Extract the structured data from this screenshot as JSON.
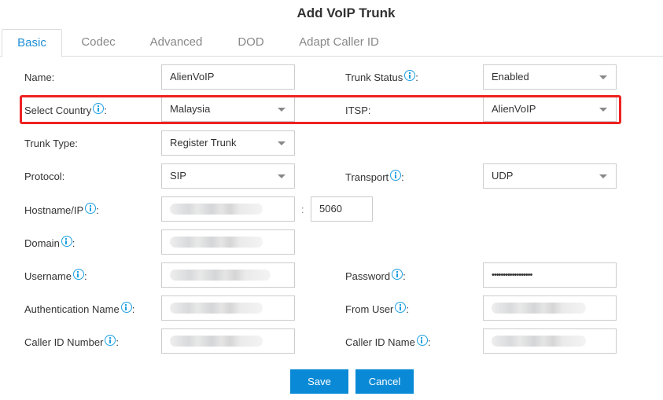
{
  "dialog": {
    "title": "Add VoIP Trunk"
  },
  "tabs": [
    {
      "label": "Basic",
      "active": true
    },
    {
      "label": "Codec",
      "active": false
    },
    {
      "label": "Advanced",
      "active": false
    },
    {
      "label": "DOD",
      "active": false
    },
    {
      "label": "Adapt Caller ID",
      "active": false
    }
  ],
  "form": {
    "name": {
      "label": "Name:",
      "value": "AlienVoIP"
    },
    "trunk_status": {
      "label": "Trunk Status",
      "suffix": ":",
      "value": "Enabled"
    },
    "select_country": {
      "label": "Select Country",
      "suffix": ":",
      "value": "Malaysia"
    },
    "itsp": {
      "label": "ITSP:",
      "value": "AlienVoIP"
    },
    "trunk_type": {
      "label": "Trunk Type:",
      "value": "Register Trunk"
    },
    "protocol": {
      "label": "Protocol:",
      "value": "SIP"
    },
    "transport": {
      "label": "Transport",
      "suffix": ":",
      "value": "UDP"
    },
    "hostname": {
      "label": "Hostname/IP",
      "suffix": ":",
      "value": "(blurred)",
      "port_separator": ":",
      "port": "5060"
    },
    "domain": {
      "label": "Domain",
      "suffix": ":",
      "value": "(blurred)"
    },
    "username": {
      "label": "Username",
      "suffix": ":",
      "value": "(blurred)"
    },
    "password": {
      "label": "Password",
      "suffix": ":",
      "value": "••••••••••••••••••"
    },
    "auth_name": {
      "label": "Authentication Name",
      "suffix": ":",
      "value": "(blurred)"
    },
    "from_user": {
      "label": "From User",
      "suffix": ":",
      "value": "(blurred)"
    },
    "caller_id_number": {
      "label": "Caller ID Number",
      "suffix": ":",
      "value": "(blurred)"
    },
    "caller_id_name": {
      "label": "Caller ID Name",
      "suffix": ":",
      "value": "(blurred)"
    }
  },
  "buttons": {
    "save": "Save",
    "cancel": "Cancel"
  },
  "colors": {
    "accent": "#1c8ed6",
    "button": "#0a8ad6",
    "highlight": "#ee2222",
    "info": "#1ea0e0"
  }
}
